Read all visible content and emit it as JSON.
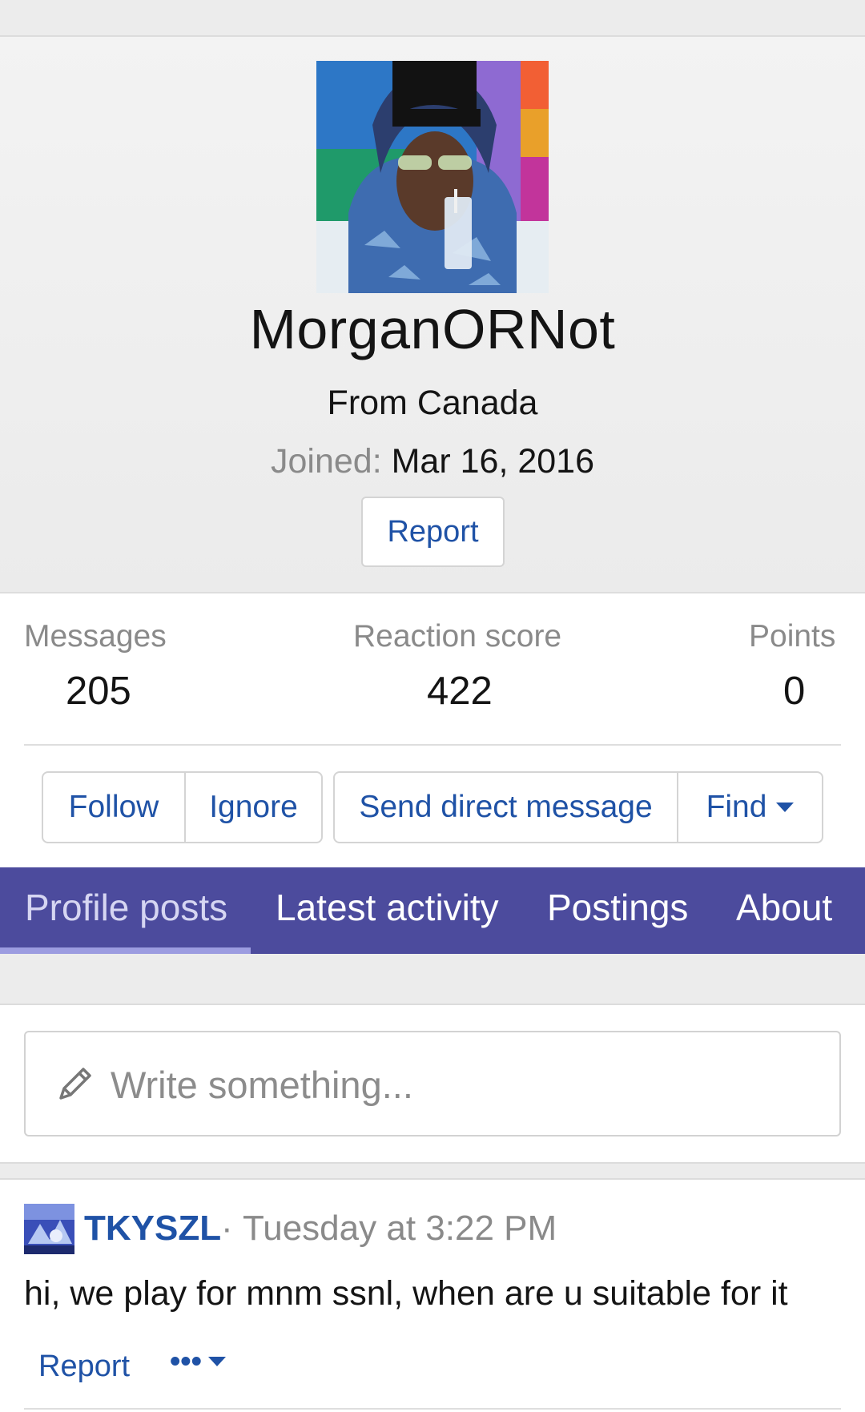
{
  "profile": {
    "username": "MorganORNot",
    "location": "From Canada",
    "joined_label": "Joined:",
    "joined_date": "Mar 16, 2016",
    "report_label": "Report"
  },
  "stats": {
    "messages_label": "Messages",
    "messages_value": "205",
    "reaction_label": "Reaction score",
    "reaction_value": "422",
    "points_label": "Points",
    "points_value": "0"
  },
  "actions": {
    "follow": "Follow",
    "ignore": "Ignore",
    "send_dm": "Send direct message",
    "find": "Find"
  },
  "tabs": {
    "profile_posts": "Profile posts",
    "latest_activity": "Latest activity",
    "postings": "Postings",
    "about": "About"
  },
  "composer": {
    "placeholder": "Write something..."
  },
  "post": {
    "author": "TKYSZL",
    "separator": "·",
    "time": "Tuesday at 3:22 PM",
    "text": "hi, we play for mnm ssnl, when are u suitable for it",
    "report_label": "Report",
    "more_label": "•••"
  },
  "colors": {
    "link_blue": "#1f52a6",
    "tab_bar": "#4c4b9d",
    "tab_active_text": "#d6d6f2",
    "muted": "#8a8a8a"
  }
}
